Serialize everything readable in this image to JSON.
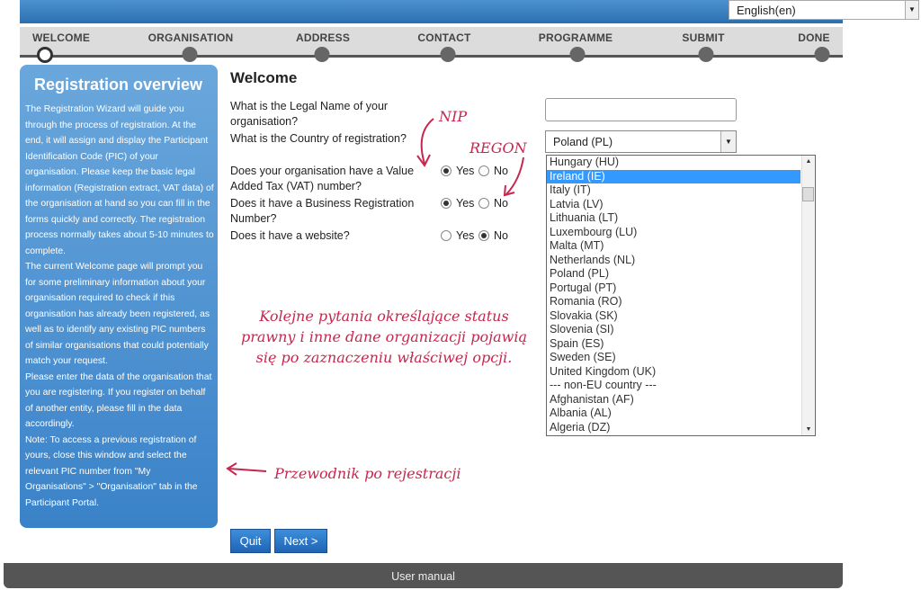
{
  "language": {
    "value": "English(en)"
  },
  "steps": [
    "WELCOME",
    "ORGANISATION",
    "ADDRESS",
    "CONTACT",
    "PROGRAMME",
    "SUBMIT",
    "DONE"
  ],
  "sidebar": {
    "title": "Registration overview",
    "paragraphs": [
      "The Registration Wizard will guide you through the process of registration. At the end, it will assign and display the Participant Identification Code (PIC) of your organisation. Please keep the basic legal information (Registration extract, VAT data) of the organisation at hand so you can fill in the forms quickly and correctly. The registration process normally takes about 5-10 minutes to complete.",
      "The current Welcome page will prompt you for some preliminary information about your organisation required to check if this organisation has already been registered, as well as to identify any existing PIC numbers of similar organisations that could potentially match your request.",
      "Please enter the data of the organisation that you are registering. If you register on behalf of another entity, please fill in the data accordingly.",
      "Note: To access a previous registration of yours, close this window and select the relevant PIC number from \"My Organisations\" > \"Organisation\" tab in the Participant Portal."
    ]
  },
  "main": {
    "title": "Welcome",
    "q_legal_name": "What is the Legal Name of your organisation?",
    "q_country": "What is the Country of registration?",
    "country_selected": "Poland (PL)",
    "q_vat": "Does your organisation have a Value Added Tax (VAT) number?",
    "q_business_reg": "Does it have a Business Registration Number?",
    "q_website": "Does it have a website?",
    "yes": "Yes",
    "no": "No"
  },
  "country_options": [
    "Hungary (HU)",
    "Ireland (IE)",
    "Italy (IT)",
    "Latvia (LV)",
    "Lithuania (LT)",
    "Luxembourg (LU)",
    "Malta (MT)",
    "Netherlands (NL)",
    "Poland (PL)",
    "Portugal (PT)",
    "Romania (RO)",
    "Slovakia (SK)",
    "Slovenia (SI)",
    "Spain (ES)",
    "Sweden (SE)",
    "United Kingdom (UK)",
    "--- non-EU country ---",
    "Afghanistan (AF)",
    "Albania (AL)",
    "Algeria (DZ)"
  ],
  "highlighted_option": "Ireland (IE)",
  "buttons": {
    "quit": "Quit",
    "next": "Next >"
  },
  "footer": "User manual",
  "annotations": {
    "nip": "NIP",
    "regon": "REGON",
    "status_note": "Kolejne pytania określające status prawny i inne dane organizacji pojawią się po zaznaczeniu właściwej opcji.",
    "guide_note": "Przewodnik po rejestracji"
  },
  "colors": {
    "accent": "#2c6fb0",
    "annotation": "#c8264f",
    "highlight": "#3399ff"
  }
}
